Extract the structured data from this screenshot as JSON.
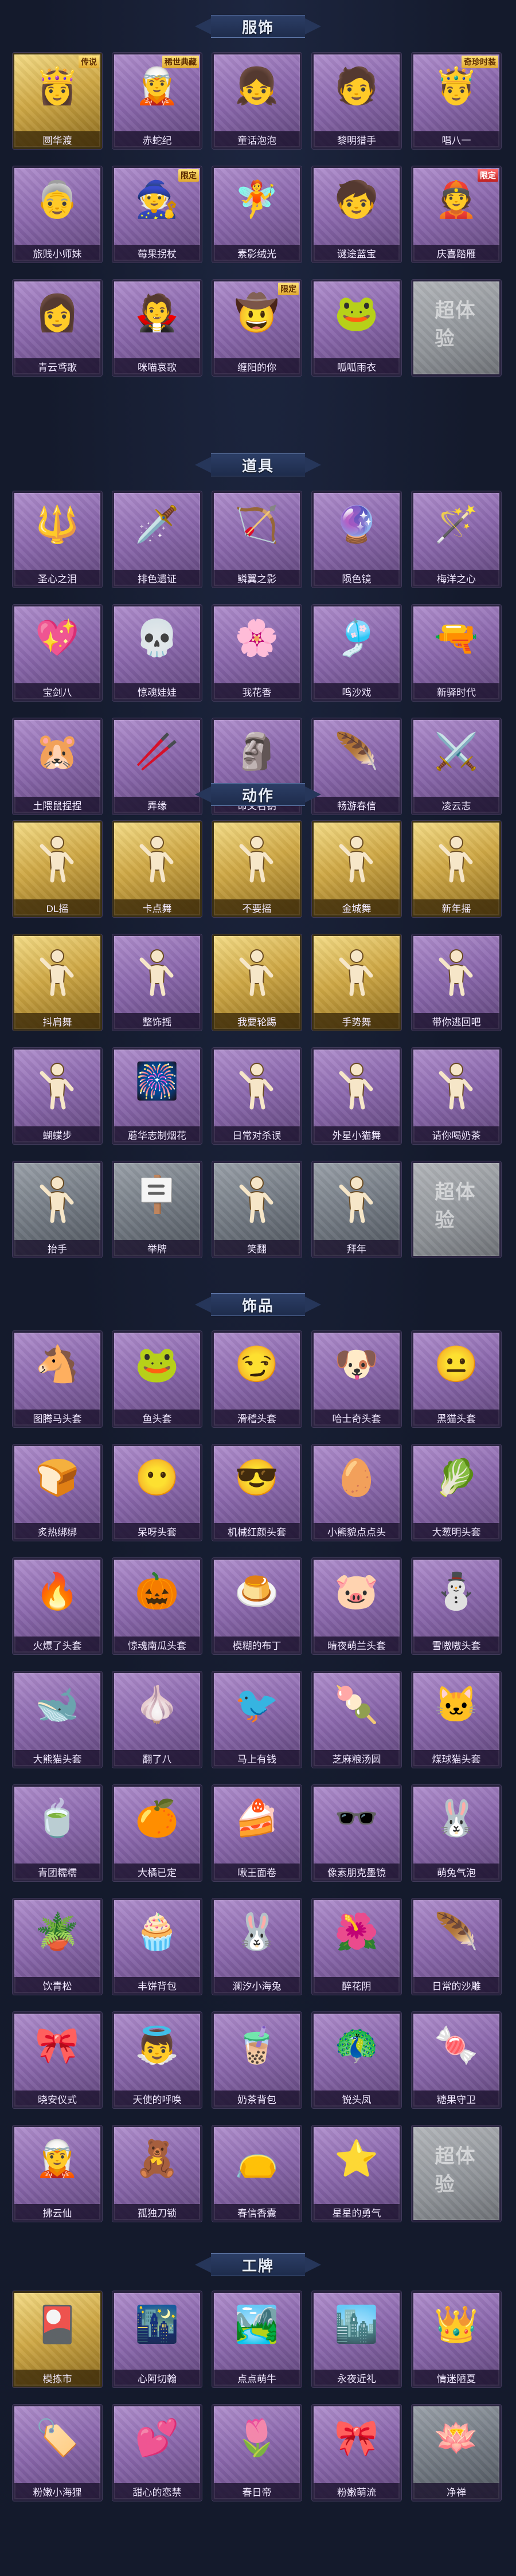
{
  "sections": [
    {
      "title": "服饰",
      "items": [
        {
          "name": "圆华渡",
          "style": "gold",
          "icon": "👸",
          "tag": "传说"
        },
        {
          "name": "赤蛇纪",
          "style": "purple",
          "icon": "🧝",
          "tag": "稀世典藏"
        },
        {
          "name": "童话泡泡",
          "style": "purple",
          "icon": "👧"
        },
        {
          "name": "黎明猎手",
          "style": "purple",
          "icon": "🧑"
        },
        {
          "name": "唱八一",
          "style": "purple",
          "icon": "🤴",
          "tag": "奇珍时装"
        },
        {
          "name": "旅贱小师妹",
          "style": "purple",
          "icon": "👵"
        },
        {
          "name": "莓果拐杖",
          "style": "purple",
          "icon": "🧙",
          "tag": "限定"
        },
        {
          "name": "素影绒光",
          "style": "purple",
          "icon": "🧚"
        },
        {
          "name": "谜途蓝宝",
          "style": "purple",
          "icon": "🧒"
        },
        {
          "name": "庆喜踏雁",
          "style": "purple",
          "icon": "👲",
          "tag": "限定",
          "tag_red": true
        },
        {
          "name": "青云鸢歌",
          "style": "purple",
          "icon": "👩"
        },
        {
          "name": "咪喵哀歌",
          "style": "purple",
          "icon": "🧛"
        },
        {
          "name": "缠阳的你",
          "style": "purple",
          "icon": "🤠",
          "tag": "限定"
        },
        {
          "name": "呱呱雨衣",
          "style": "purple",
          "icon": "🐸"
        },
        {
          "name": "",
          "style": "locked",
          "icon": "",
          "locked": true
        }
      ]
    },
    {
      "title": "道具",
      "items": [
        {
          "name": "圣心之泪",
          "style": "purple",
          "icon": "🔱"
        },
        {
          "name": "排色遗证",
          "style": "purple",
          "icon": "🗡️"
        },
        {
          "name": "鳞翼之影",
          "style": "purple",
          "icon": "🏹"
        },
        {
          "name": "陨色镜",
          "style": "purple",
          "icon": "🔮"
        },
        {
          "name": "梅洋之心",
          "style": "purple",
          "icon": "🪄"
        },
        {
          "name": "宝剑八",
          "style": "purple",
          "icon": "💖"
        },
        {
          "name": "惊魂娃娃",
          "style": "purple",
          "icon": "💀"
        },
        {
          "name": "我花香",
          "style": "purple",
          "icon": "🌸"
        },
        {
          "name": "鸣沙戏",
          "style": "purple",
          "icon": "🎐"
        },
        {
          "name": "新驿时代",
          "style": "purple",
          "icon": "🔫"
        },
        {
          "name": "土隈鼠捏捏",
          "style": "purple",
          "icon": "🐹"
        },
        {
          "name": "弄缘",
          "style": "purple",
          "icon": "🥢"
        },
        {
          "name": "命文名钥",
          "style": "purple",
          "icon": "🗿"
        },
        {
          "name": "畅游春信",
          "style": "purple",
          "icon": "🪶"
        },
        {
          "name": "凌云志",
          "style": "purple",
          "icon": "⚔️"
        }
      ]
    },
    {
      "title": "动作",
      "items": [
        {
          "name": "DL摇",
          "style": "gold",
          "emote": true
        },
        {
          "name": "卡点舞",
          "style": "gold",
          "emote": true
        },
        {
          "name": "不要摇",
          "style": "gold",
          "emote": true
        },
        {
          "name": "金城舞",
          "style": "gold",
          "emote": true
        },
        {
          "name": "新年摇",
          "style": "gold",
          "emote": true
        },
        {
          "name": "抖肩舞",
          "style": "gold",
          "emote": true
        },
        {
          "name": "整饰摇",
          "style": "purple",
          "emote": true
        },
        {
          "name": "我要轮踢",
          "style": "gold",
          "emote": true
        },
        {
          "name": "手势舞",
          "style": "gold",
          "emote": true
        },
        {
          "name": "带你逃回吧",
          "style": "purple",
          "emote": true
        },
        {
          "name": "蝴蝶步",
          "style": "purple",
          "emote": true
        },
        {
          "name": "蘑华志制烟花",
          "style": "purple",
          "icon": "🎆"
        },
        {
          "name": "日常对杀误",
          "style": "purple",
          "emote": true
        },
        {
          "name": "外星小猫舞",
          "style": "purple",
          "emote": true
        },
        {
          "name": "请你喝奶茶",
          "style": "purple",
          "emote": true
        },
        {
          "name": "抬手",
          "style": "grey",
          "emote": true
        },
        {
          "name": "举牌",
          "style": "grey",
          "icon": "🪧"
        },
        {
          "name": "笑翻",
          "style": "grey",
          "emote": true
        },
        {
          "name": "拜年",
          "style": "grey",
          "emote": true
        },
        {
          "name": "",
          "style": "locked",
          "icon": "",
          "locked": true
        }
      ]
    },
    {
      "title": "饰品",
      "items": [
        {
          "name": "图腾马头套",
          "style": "purple",
          "icon": "🐴"
        },
        {
          "name": "鱼头套",
          "style": "purple",
          "icon": "🐸"
        },
        {
          "name": "滑稽头套",
          "style": "purple",
          "icon": "😏"
        },
        {
          "name": "哈士奇头套",
          "style": "purple",
          "icon": "🐶"
        },
        {
          "name": "黑猫头套",
          "style": "purple",
          "icon": "😐"
        },
        {
          "name": "炙热绑绑",
          "style": "purple",
          "icon": "🍞"
        },
        {
          "name": "呆呀头套",
          "style": "purple",
          "icon": "😶"
        },
        {
          "name": "机械红颜头套",
          "style": "purple",
          "icon": "😎"
        },
        {
          "name": "小熊貌点点头",
          "style": "purple",
          "icon": "🥚"
        },
        {
          "name": "大葱明头套",
          "style": "purple",
          "icon": "🥬"
        },
        {
          "name": "火爆了头套",
          "style": "purple",
          "icon": "🔥"
        },
        {
          "name": "惊魂南瓜头套",
          "style": "purple",
          "icon": "🎃"
        },
        {
          "name": "模糊的布丁",
          "style": "purple",
          "icon": "🍮"
        },
        {
          "name": "晴夜萌兰头套",
          "style": "purple",
          "icon": "🐷"
        },
        {
          "name": "雪嗷嗷头套",
          "style": "purple",
          "icon": "⛄"
        },
        {
          "name": "大熊猫头套",
          "style": "purple",
          "icon": "🐋"
        },
        {
          "name": "翻了八",
          "style": "purple",
          "icon": "🧄"
        },
        {
          "name": "马上有钱",
          "style": "purple",
          "icon": "🐦"
        },
        {
          "name": "芝麻粮汤圆",
          "style": "purple",
          "icon": "🍡"
        },
        {
          "name": "煤球猫头套",
          "style": "purple",
          "icon": "🐱"
        },
        {
          "name": "青团糯糯",
          "style": "purple",
          "icon": "🍵"
        },
        {
          "name": "大橘已定",
          "style": "purple",
          "icon": "🍊"
        },
        {
          "name": "啾王面卷",
          "style": "purple",
          "icon": "🍰"
        },
        {
          "name": "像素朋克墨镜",
          "style": "purple",
          "icon": "🕶️"
        },
        {
          "name": "萌兔气泡",
          "style": "purple",
          "icon": "🐰"
        },
        {
          "name": "饮青松",
          "style": "purple",
          "icon": "🪴"
        },
        {
          "name": "丰饼背包",
          "style": "purple",
          "icon": "🧁"
        },
        {
          "name": "澜汐小海兔",
          "style": "purple",
          "icon": "🐰"
        },
        {
          "name": "醉花阴",
          "style": "purple",
          "icon": "🌺"
        },
        {
          "name": "日常的沙雕",
          "style": "purple",
          "icon": "🪶"
        },
        {
          "name": "晓安仪式",
          "style": "purple",
          "icon": "🎀"
        },
        {
          "name": "天使的呼唤",
          "style": "purple",
          "icon": "👼"
        },
        {
          "name": "奶茶背包",
          "style": "purple",
          "icon": "🧋"
        },
        {
          "name": "锐头凤",
          "style": "purple",
          "icon": "🦚"
        },
        {
          "name": "糖果守卫",
          "style": "purple",
          "icon": "🍬"
        },
        {
          "name": "拂云仙",
          "style": "purple",
          "icon": "🧝"
        },
        {
          "name": "孤独刀锁",
          "style": "purple",
          "icon": "🧸"
        },
        {
          "name": "春信香囊",
          "style": "purple",
          "icon": "👝"
        },
        {
          "name": "星星的勇气",
          "style": "purple",
          "icon": "⭐"
        },
        {
          "name": "",
          "style": "locked",
          "icon": "",
          "locked": true
        }
      ]
    },
    {
      "title": "工牌",
      "items": [
        {
          "name": "模拣市",
          "style": "gold",
          "icon": "🎴"
        },
        {
          "name": "心阿切翰",
          "style": "purple",
          "icon": "🌃"
        },
        {
          "name": "点点萌牛",
          "style": "purple",
          "icon": "🏞️"
        },
        {
          "name": "永夜近礼",
          "style": "purple",
          "icon": "🏙️"
        },
        {
          "name": "情迷陋夏",
          "style": "purple",
          "icon": "👑"
        },
        {
          "name": "粉嫩小海狸",
          "style": "purple",
          "icon": "🏷️"
        },
        {
          "name": "甜心的恋禁",
          "style": "purple",
          "icon": "💕"
        },
        {
          "name": "春日帝",
          "style": "purple",
          "icon": "🌷"
        },
        {
          "name": "粉嫩萌流",
          "style": "purple",
          "icon": "🎀"
        },
        {
          "name": "净禅",
          "style": "grey",
          "icon": "🪷"
        }
      ]
    }
  ],
  "locked_watermark": "超体验"
}
